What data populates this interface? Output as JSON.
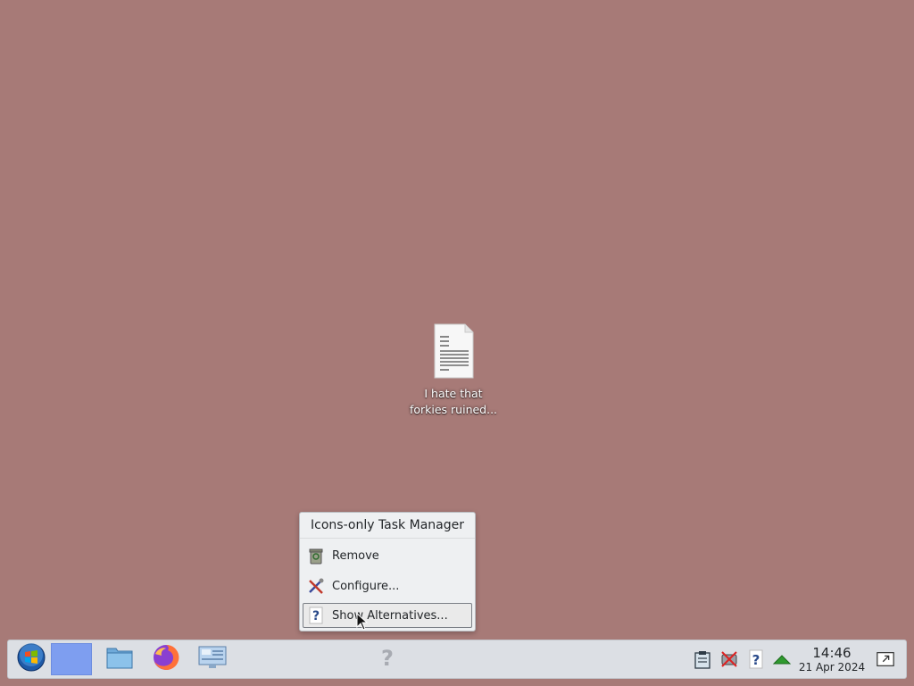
{
  "desktop": {
    "background_color": "#a77a77",
    "icons": [
      {
        "label_line1": "I hate that",
        "label_line2": "forkies ruined...",
        "icon": "text-document-icon"
      }
    ]
  },
  "context_menu": {
    "title": "Icons-only Task Manager",
    "items": [
      {
        "label": "Remove",
        "icon": "trash-icon"
      },
      {
        "label": "Configure...",
        "icon": "configure-tools-icon"
      },
      {
        "label": "Show Alternatives...",
        "icon": "question-icon",
        "highlighted": true
      }
    ]
  },
  "taskbar": {
    "launchers": [
      {
        "name": "application-launcher",
        "icon": "start-orb-icon"
      },
      {
        "name": "active-window",
        "icon": "blank-window-icon"
      },
      {
        "name": "file-manager",
        "icon": "folder-icon"
      },
      {
        "name": "web-browser",
        "icon": "firefox-icon"
      },
      {
        "name": "system-settings",
        "icon": "settings-monitor-icon"
      }
    ],
    "center_icon": "question-icon",
    "tray": {
      "icons": [
        "clipboard-icon",
        "network-disconnected-icon",
        "help-icon",
        "updates-arrow-icon"
      ],
      "clock_time": "14:46",
      "clock_date": "21 Apr 2024",
      "show_desktop_icon": "show-desktop-icon"
    }
  }
}
